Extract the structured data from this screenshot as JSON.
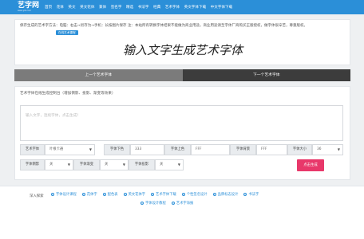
{
  "logo": {
    "text": "艺字网",
    "sub": "www.yizi.com"
  },
  "nav": [
    "首页",
    "花体",
    "英文",
    "英文花体",
    "篆体",
    "签名字",
    "精选",
    "书法字",
    "经典",
    "艺术字体",
    "英文字体下载",
    "中文字体下载"
  ],
  "notice": {
    "text": "保存生成的艺术字方法：电脑：右击→另存为→手机：长按图片保存 注：本站所有转换字体结果不能做为商业用途，商业用途请至字体厂商购买正版授权，做字体很辛苦，尊重版权。",
    "badge": "在线艺术课程"
  },
  "preview": {
    "text": "输入文字生成艺术字体"
  },
  "tabs": {
    "prev": "上一个艺术字体",
    "next": "下一个艺术字体"
  },
  "form": {
    "title": "艺术字体在线生成控制台（增加倒影、投影、渐变等效果）",
    "textarea_placeholder": "输入文字，连续字体，点击生成！",
    "font_label": "艺术字体",
    "font_value": "叶根卡通",
    "color_label": "字体下色",
    "color_value": "333",
    "color2_label": "字体上色",
    "color2_value": "FFF",
    "bg_label": "字体背景",
    "bg_value": "FFF",
    "size_label": "字体大小",
    "size_value": "36",
    "reflect_label": "字体倒影",
    "reflect_value": "关",
    "gradient_label": "字体渐变",
    "gradient_value": "关",
    "shadow_label": "字体投影",
    "shadow_value": "关",
    "generate": "点击生成"
  },
  "footer": {
    "title": "深入探索",
    "links": [
      "字体设计课程",
      "花体字",
      "配色表",
      "英文花体字",
      "艺术字体下载",
      "个性签名设计",
      "品牌标志设计",
      "书法字",
      "字体设计教程",
      "艺术字海报"
    ]
  }
}
